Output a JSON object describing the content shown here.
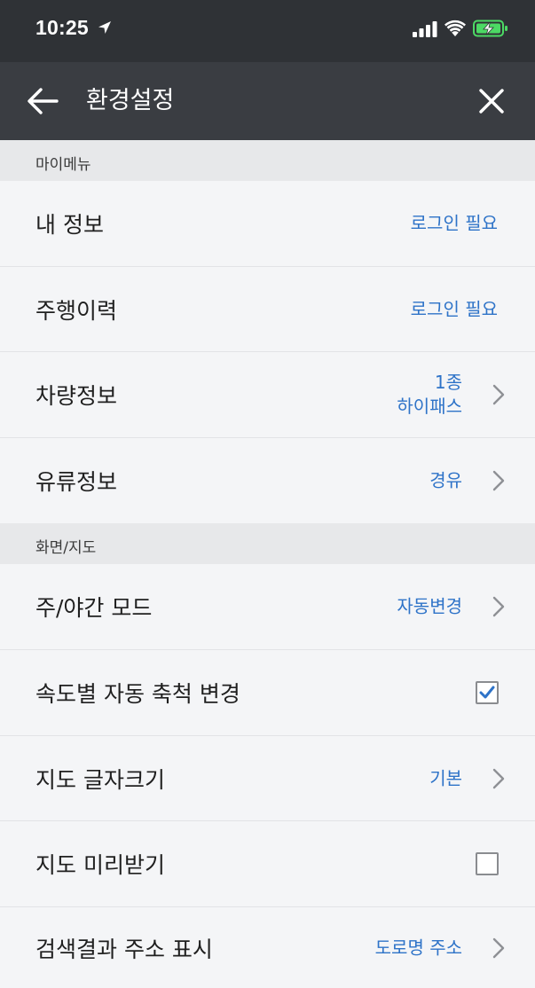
{
  "status_bar": {
    "time": "10:25",
    "location_icon": "location-arrow-icon",
    "signal_icon": "cellular-signal-icon",
    "wifi_icon": "wifi-icon",
    "battery_icon": "battery-charging-icon",
    "battery_color": "#4cd964"
  },
  "header": {
    "title": "환경설정",
    "back_icon": "back-arrow-icon",
    "close_icon": "close-icon",
    "background": "#3a3d42"
  },
  "accent_color": "#2e73c8",
  "sections": {
    "my_menu": {
      "title": "마이메뉴",
      "items": [
        {
          "label": "내 정보",
          "value": "로그인 필요"
        },
        {
          "label": "주행이력",
          "value": "로그인 필요"
        },
        {
          "label": "차량정보",
          "value_line1": "1종",
          "value_line2": "하이패스",
          "chevron": true
        },
        {
          "label": "유류정보",
          "value": "경유",
          "chevron": true
        }
      ]
    },
    "display_map": {
      "title": "화면/지도",
      "items": [
        {
          "label": "주/야간 모드",
          "value": "자동변경",
          "chevron": true
        },
        {
          "label": "속도별 자동 축척 변경",
          "checked": true
        },
        {
          "label": "지도 글자크기",
          "value": "기본",
          "chevron": true
        },
        {
          "label": "지도 미리받기",
          "checked": false
        },
        {
          "label": "검색결과 주소 표시",
          "value": "도로명 주소",
          "chevron": true
        }
      ]
    }
  }
}
